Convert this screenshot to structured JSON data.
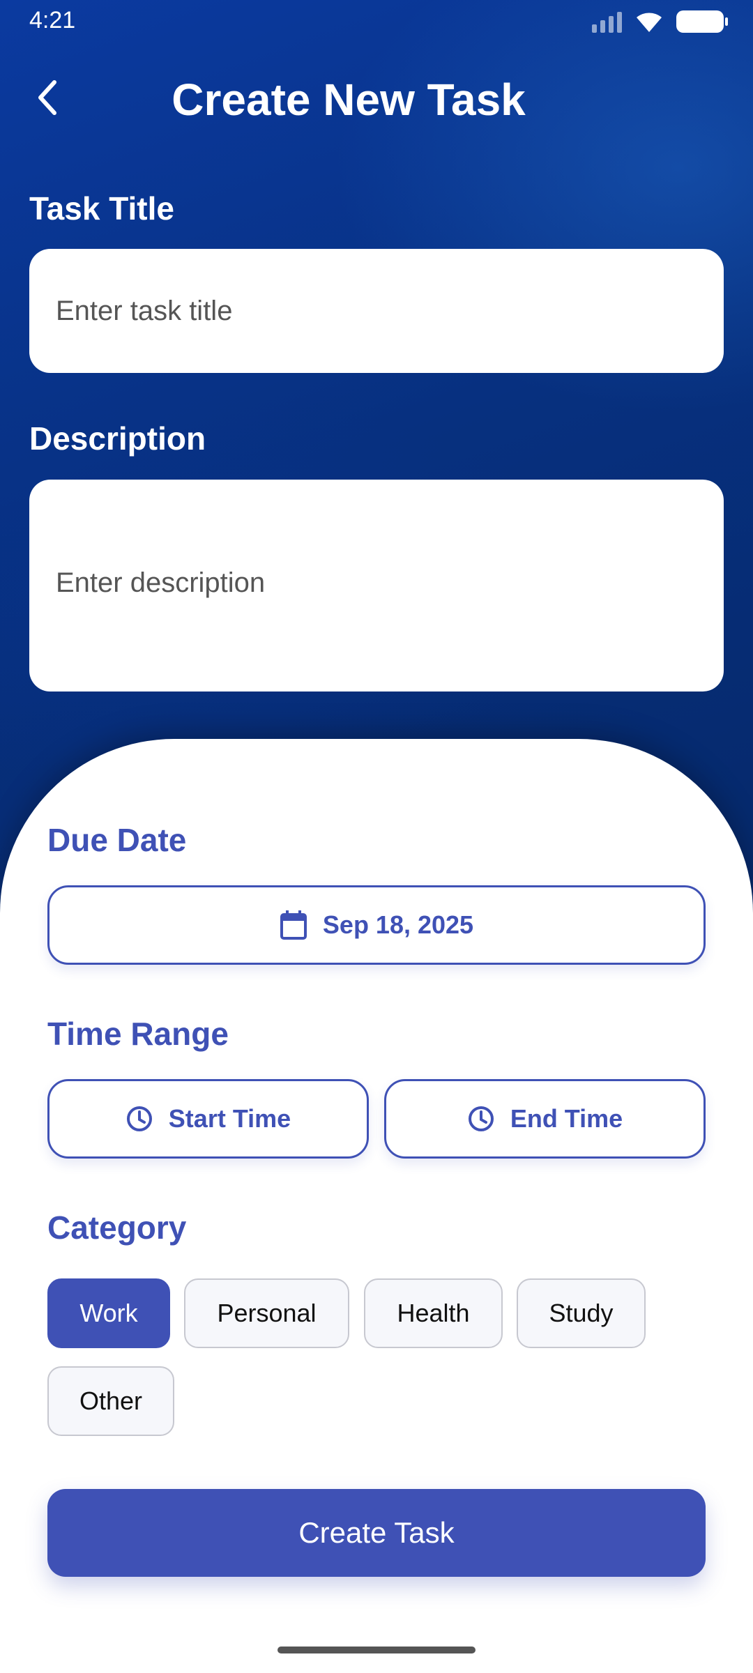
{
  "status_bar": {
    "time": "4:21"
  },
  "header": {
    "title": "Create New Task"
  },
  "form": {
    "title_label": "Task Title",
    "title_placeholder": "Enter task title",
    "title_value": "",
    "description_label": "Description",
    "description_placeholder": "Enter description",
    "description_value": ""
  },
  "sheet": {
    "due_date_label": "Due Date",
    "due_date_value": "Sep 18, 2025",
    "time_range_label": "Time Range",
    "start_time_label": "Start Time",
    "end_time_label": "End Time",
    "category_label": "Category",
    "categories": [
      {
        "label": "Work",
        "selected": true
      },
      {
        "label": "Personal",
        "selected": false
      },
      {
        "label": "Health",
        "selected": false
      },
      {
        "label": "Study",
        "selected": false
      },
      {
        "label": "Other",
        "selected": false
      }
    ],
    "create_button_label": "Create Task"
  },
  "icons": {
    "back": "chevron-left-icon",
    "calendar": "calendar-icon",
    "clock": "clock-icon",
    "signal": "signal-icon",
    "wifi": "wifi-icon",
    "battery": "battery-icon"
  },
  "colors": {
    "accent": "#3f51b5",
    "header_bg": "#062a6e",
    "chip_bg": "#f6f7fb"
  }
}
